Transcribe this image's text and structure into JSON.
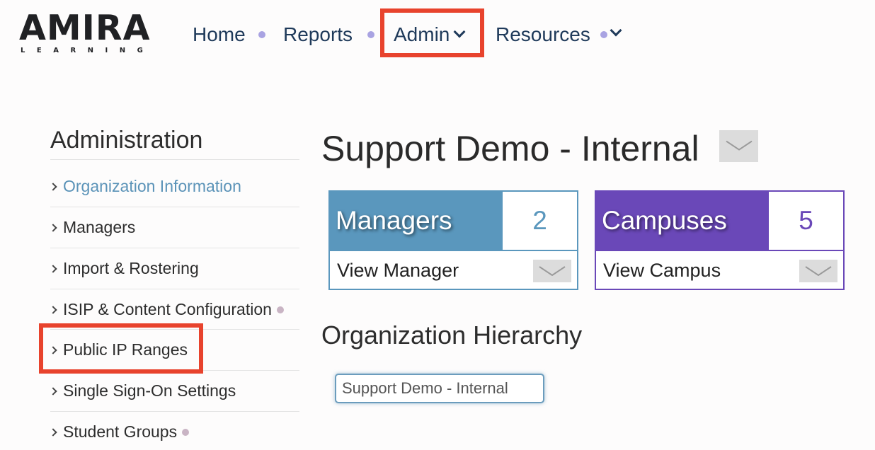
{
  "header": {
    "logo_text": "AMIRA",
    "logo_subtext": "LEARNING",
    "nav": [
      {
        "label": "Home",
        "has_dot": true
      },
      {
        "label": "Reports",
        "has_dot": true
      },
      {
        "label": "Admin",
        "has_dropdown": true,
        "highlighted": true
      },
      {
        "label": "Resources",
        "has_dot": true,
        "has_dropdown": true
      }
    ]
  },
  "sidebar": {
    "title": "Administration",
    "items": [
      {
        "label": "Organization Information",
        "active": true,
        "icon": "chevron-right-icon"
      },
      {
        "label": "Managers",
        "icon": "chevron-right-icon"
      },
      {
        "label": "Import & Rostering",
        "icon": "chevron-right-icon"
      },
      {
        "label": "ISIP & Content Configuration",
        "has_dot": true,
        "icon": "chevron-right-icon"
      },
      {
        "label": "Public IP Ranges",
        "highlighted": true,
        "icon": "chevron-right-icon"
      },
      {
        "label": "Single Sign-On Settings",
        "icon": "chevron-right-icon"
      },
      {
        "label": "Student Groups",
        "has_dot": true,
        "icon": "chevron-right-icon"
      }
    ]
  },
  "main": {
    "org_title": "Support Demo - Internal",
    "cards": {
      "managers": {
        "label": "Managers",
        "count": "2",
        "action": "View Manager",
        "color": "#5a97bd"
      },
      "campuses": {
        "label": "Campuses",
        "count": "5",
        "action": "View Campus",
        "color": "#6a48b8"
      }
    },
    "hierarchy": {
      "title": "Organization Hierarchy",
      "root_node": "Support Demo - Internal"
    }
  },
  "colors": {
    "highlight": "#e8432d",
    "nav_text": "#1f3a5a",
    "nav_dot": "#a9a3e2",
    "active_link": "#5b93b8"
  }
}
